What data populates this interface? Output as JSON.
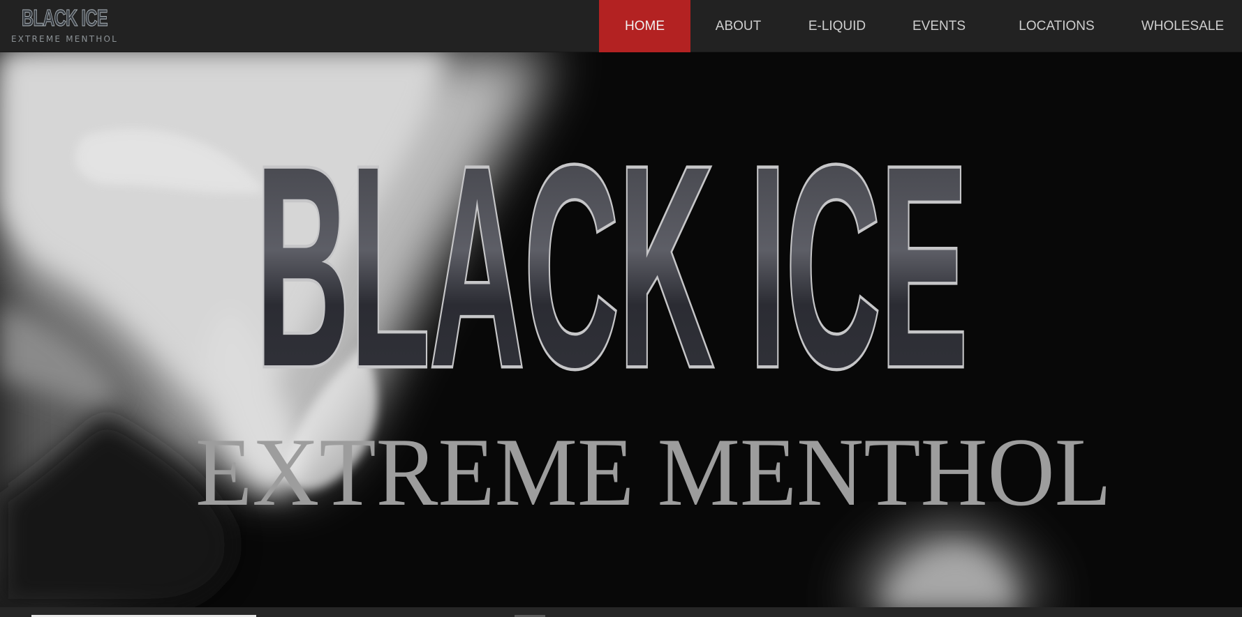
{
  "logo": {
    "title": "BLACK ICE",
    "subtitle": "EXTREME MENTHOL"
  },
  "nav": {
    "items": [
      {
        "label": "HOME",
        "active": true
      },
      {
        "label": "ABOUT",
        "active": false
      },
      {
        "label": "E-LIQUID",
        "active": false
      },
      {
        "label": "EVENTS",
        "active": false
      },
      {
        "label": "LOCATIONS",
        "active": false
      },
      {
        "label": "WHOLESALE",
        "active": false
      }
    ]
  },
  "hero": {
    "title": "BLACK ICE",
    "subtitle": "EXTREME MENTHOL"
  },
  "colors": {
    "header_bg": "#222222",
    "nav_active_bg": "#b32222",
    "nav_text": "#cfcfcf",
    "hero_bg": "#090909",
    "title_outline": "#c4c4c6",
    "subtitle_text": "#9c9c9c"
  }
}
